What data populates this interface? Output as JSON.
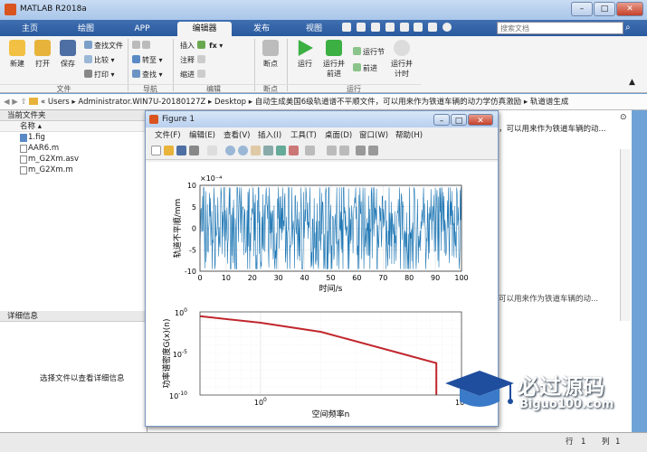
{
  "window": {
    "title": "MATLAB R2018a"
  },
  "tabs": [
    "主页",
    "绘图",
    "APP",
    "编辑器",
    "发布",
    "视图"
  ],
  "search": {
    "placeholder": "搜索文档"
  },
  "ribbon": {
    "file": {
      "new": "新建",
      "open": "打开",
      "save": "保存",
      "find_files": "查找文件",
      "compare": "比较",
      "print": "打印",
      "section": "文件"
    },
    "nav": {
      "goto": "转至",
      "find": "查找",
      "section": "导航"
    },
    "edit": {
      "insert": "插入",
      "comment": "注释",
      "indent": "缩进",
      "fx": "fx",
      "section": "编辑"
    },
    "breakpoints": {
      "label": "断点",
      "section": "断点"
    },
    "run": {
      "run": "运行",
      "run_advance": "运行并\n前进",
      "run_section": "运行节",
      "advance": "前进",
      "run_time": "运行并\n计时",
      "section": "运行"
    }
  },
  "address": {
    "path": [
      "Users",
      "Administrator.WIN7U-20180127Z",
      "Desktop",
      "自动生成美国6级轨道谱不平顺文件，可以用来作为铁道车辆的动力学仿真激励",
      "轨道谱生成"
    ]
  },
  "current_folder": {
    "title": "当前文件夹",
    "col_name": "名称",
    "files": [
      "1.fig",
      "AAR6.m",
      "m_G2Xm.asv",
      "m_G2Xm.m"
    ]
  },
  "details": {
    "title": "详细信息",
    "empty_msg": "选择文件以查看详细信息"
  },
  "cmd_snippet1": "，可以用来作为铁道车辆的动...",
  "cmd_snippet2": "可以用来作为铁道车辆的动...",
  "status": {
    "row_label": "行",
    "row": "1",
    "col_label": "列",
    "col": "1"
  },
  "figure": {
    "title": "Figure 1",
    "menu": [
      "文件(F)",
      "编辑(E)",
      "查看(V)",
      "插入(I)",
      "工具(T)",
      "桌面(D)",
      "窗口(W)",
      "帮助(H)"
    ]
  },
  "watermark": {
    "brand": "必过源码",
    "url": "Biguo100.com"
  },
  "chart_data": [
    {
      "type": "line",
      "title": "",
      "xlabel": "时间/s",
      "ylabel": "轨道不平顺/mm",
      "y_exponent": "×10⁻⁴",
      "xlim": [
        0,
        100
      ],
      "ylim": [
        -10,
        10
      ],
      "xticks": [
        0,
        10,
        20,
        30,
        40,
        50,
        60,
        70,
        80,
        90,
        100
      ],
      "yticks": [
        -10,
        -5,
        0,
        5,
        10
      ],
      "color": "#1f77b4",
      "note_series": "random noise, approx. uniform amplitude ±7e-4, 1000+ samples",
      "grid": true
    },
    {
      "type": "line",
      "title": "",
      "xlabel": "空间频率n",
      "ylabel": "功率谱密度G(x)(n)",
      "xscale": "log",
      "yscale": "log",
      "xlim": [
        0.5,
        10
      ],
      "ylim": [
        1e-10,
        1
      ],
      "xticks": [
        "10^0",
        "10^1"
      ],
      "yticks": [
        "10^-10",
        "10^-5",
        "10^0"
      ],
      "color": "#c0272d",
      "grid": true,
      "x": [
        0.5,
        1,
        2,
        5,
        7.5,
        7.5
      ],
      "y": [
        0.3,
        0.05,
        0.004,
        1e-05,
        7e-07,
        1e-10
      ]
    }
  ]
}
